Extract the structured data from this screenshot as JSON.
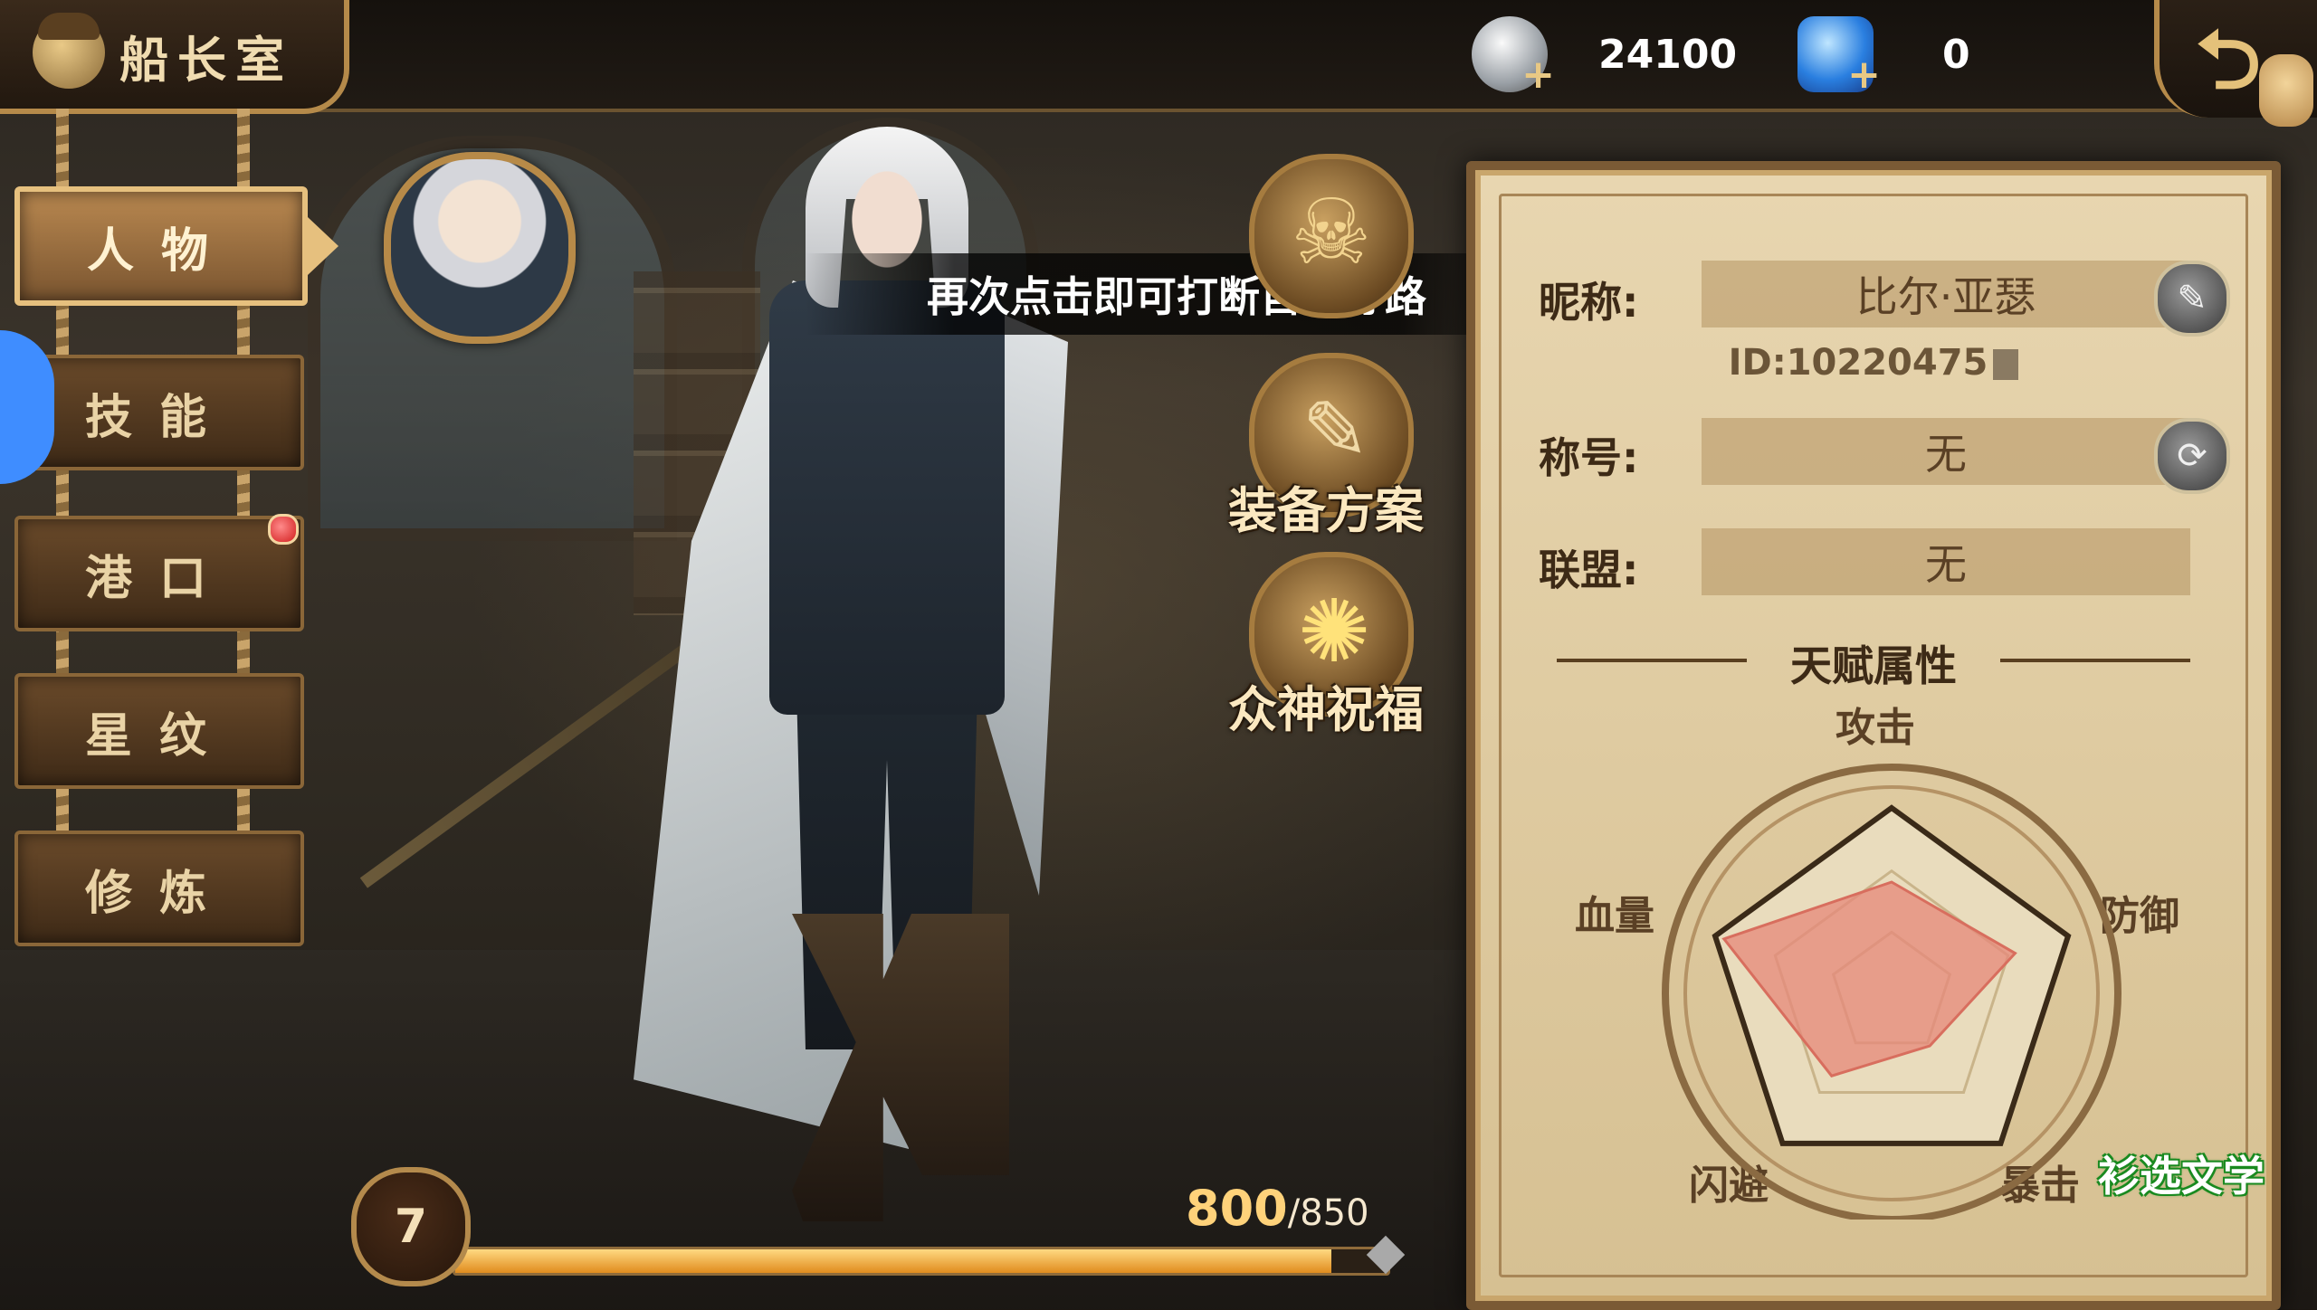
{
  "header": {
    "title": "船长室",
    "silver_value": "24100",
    "gem_value": "0"
  },
  "menu": [
    {
      "label": "人物",
      "active": true
    },
    {
      "label": "技能",
      "active": false
    },
    {
      "label": "港口",
      "active": false,
      "badge": true
    },
    {
      "label": "星纹",
      "active": false
    },
    {
      "label": "修炼",
      "active": false
    }
  ],
  "tooltip": "再次点击即可打断自动寻路",
  "features": {
    "equip_plan": "装备方案",
    "gods_blessing": "众神祝福"
  },
  "level": {
    "value": "7",
    "xp_current": "800",
    "xp_max": "/850",
    "progress": 0.94
  },
  "profile": {
    "nickname_label": "昵称:",
    "nickname": "比尔·亚瑟",
    "id_text": "ID:10220475",
    "title_label": "称号:",
    "title_value": "无",
    "alliance_label": "联盟:",
    "alliance_value": "无"
  },
  "talent": {
    "section_title": "天赋属性",
    "attack": "攻击",
    "defense": "防御",
    "crit": "暴击",
    "dodge": "闪避",
    "hp": "血量",
    "values": {
      "attack": 0.6,
      "defense": 0.7,
      "crit": 0.35,
      "dodge": 0.55,
      "hp": 0.95
    }
  },
  "watermark": "衫选文学",
  "colors": {
    "accent_gold": "#b58a4a",
    "parchment": "#e8d6b0",
    "radar_fill": "#e5887a",
    "xp_fill": "#f0a030"
  }
}
